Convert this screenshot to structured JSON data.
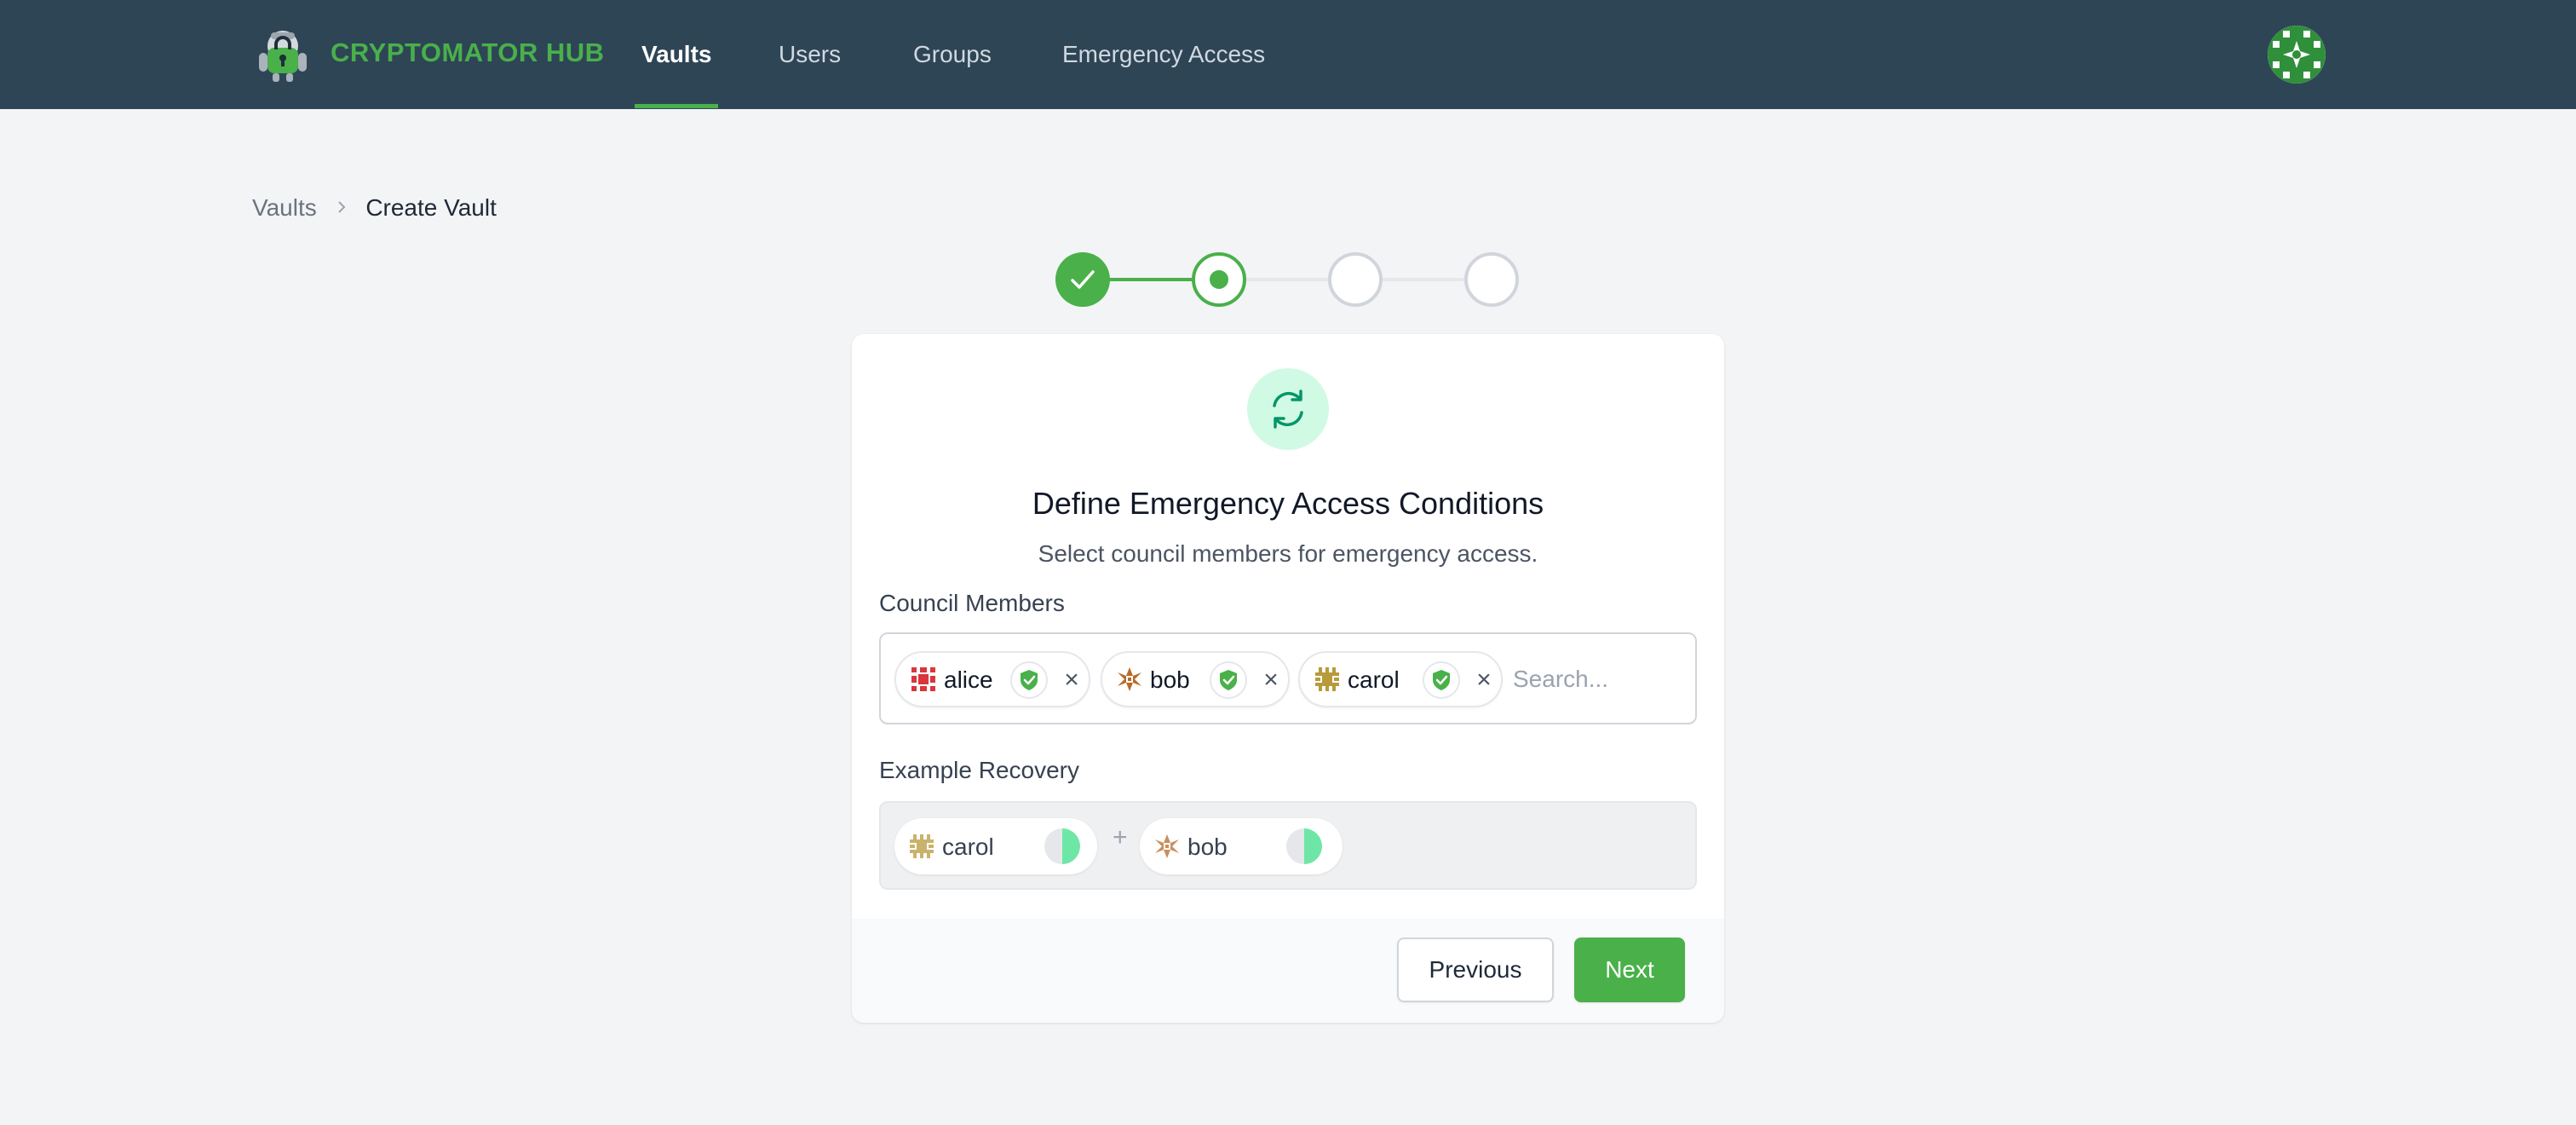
{
  "colors": {
    "header_bg": "#2e4556",
    "brand_green": "#49b04a",
    "page_bg": "#f3f4f6",
    "icon_circle_bg": "#d1fae5"
  },
  "header": {
    "brand": "CRYPTOMATOR HUB",
    "logo_icon": "cryptomator-robot-logo-icon",
    "nav": [
      {
        "label": "Vaults",
        "active": true
      },
      {
        "label": "Users",
        "active": false
      },
      {
        "label": "Groups",
        "active": false
      },
      {
        "label": "Emergency Access",
        "active": false
      }
    ],
    "avatar_icon": "user-avatar-icon"
  },
  "breadcrumb": {
    "items": [
      "Vaults",
      "Create Vault"
    ],
    "separator_icon": "chevron-right-icon"
  },
  "stepper": {
    "total": 4,
    "current": 2,
    "steps": [
      "complete",
      "current",
      "upcoming",
      "upcoming"
    ]
  },
  "card": {
    "icon": "arrows-rotate-icon",
    "title": "Define Emergency Access Conditions",
    "subtitle": "Select council members for emergency access.",
    "council": {
      "label": "Council Members",
      "members": [
        {
          "name": "alice",
          "avatar_color": "#d9363e",
          "verified_icon": "shield-check-icon",
          "remove_label": "×"
        },
        {
          "name": "bob",
          "avatar_color": "#b86a2a",
          "verified_icon": "shield-check-icon",
          "remove_label": "×"
        },
        {
          "name": "carol",
          "avatar_color": "#b89a3a",
          "verified_icon": "shield-check-icon",
          "remove_label": "×"
        }
      ],
      "search_placeholder": "Search..."
    },
    "recovery": {
      "label": "Example Recovery",
      "members": [
        {
          "name": "carol",
          "share": 0.5
        },
        {
          "name": "bob",
          "share": 0.5
        }
      ],
      "joiner": "+"
    },
    "buttons": {
      "previous": "Previous",
      "next": "Next"
    }
  }
}
